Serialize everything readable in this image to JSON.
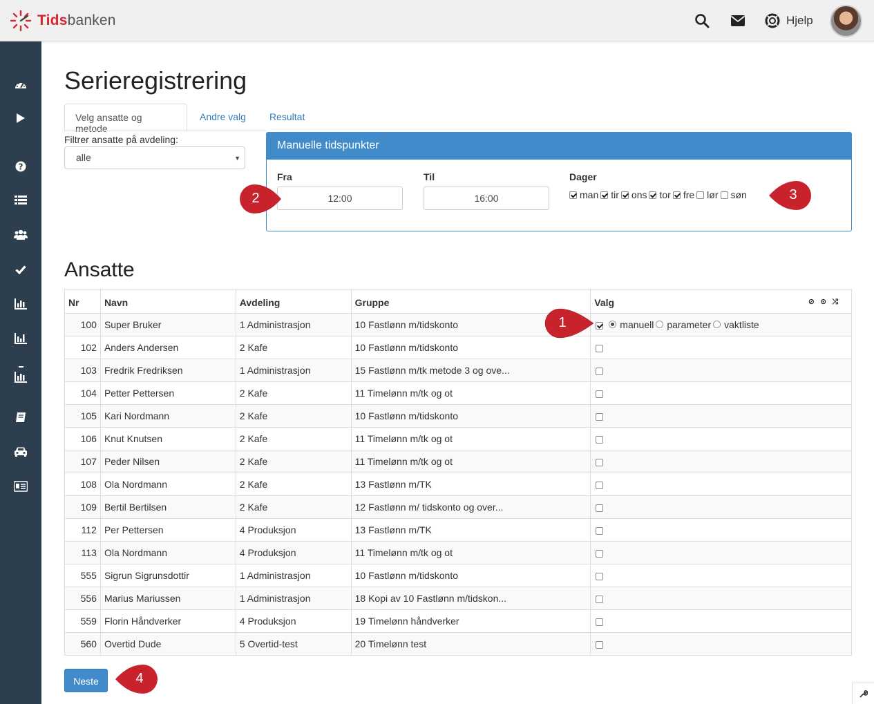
{
  "app": {
    "logo_part1": "Tids",
    "logo_part2": "banken"
  },
  "header": {
    "help_label": "Hjelp"
  },
  "sidebar": {
    "icons": [
      "dashboard-icon",
      "play-icon",
      "question-icon",
      "list-icon",
      "users-icon",
      "check-icon",
      "bar-chart-icon",
      "bar-chart-icon",
      "bar-chart-minus-icon",
      "book-icon",
      "car-icon",
      "id-card-icon"
    ]
  },
  "page": {
    "title": "Serieregistrering"
  },
  "tabs": [
    {
      "label": "Velg ansatte og metode",
      "active": true
    },
    {
      "label": "Andre valg",
      "active": false
    },
    {
      "label": "Resultat",
      "active": false
    }
  ],
  "filter": {
    "label": "Filtrer ansatte på avdeling:",
    "value": "alle"
  },
  "panel": {
    "title": "Manuelle tidspunkter",
    "fra_label": "Fra",
    "fra_value": "12:00",
    "til_label": "Til",
    "til_value": "16:00",
    "dager_label": "Dager",
    "days": [
      {
        "label": "man",
        "checked": true
      },
      {
        "label": "tir",
        "checked": true
      },
      {
        "label": "ons",
        "checked": true
      },
      {
        "label": "tor",
        "checked": true
      },
      {
        "label": "fre",
        "checked": true
      },
      {
        "label": "lør",
        "checked": false
      },
      {
        "label": "søn",
        "checked": false
      }
    ]
  },
  "employees": {
    "title": "Ansatte",
    "columns": [
      "Nr",
      "Navn",
      "Avdeling",
      "Gruppe",
      "Valg"
    ],
    "valg_options": [
      "manuell",
      "parameter",
      "vaktliste"
    ],
    "rows": [
      {
        "nr": "100",
        "navn": "Super Bruker",
        "avdeling": "1 Administrasjon",
        "gruppe": "10 Fastlønn m/tidskonto",
        "checked": true
      },
      {
        "nr": "102",
        "navn": "Anders Andersen",
        "avdeling": "2 Kafe",
        "gruppe": "10 Fastlønn m/tidskonto",
        "checked": false
      },
      {
        "nr": "103",
        "navn": "Fredrik Fredriksen",
        "avdeling": "1 Administrasjon",
        "gruppe": "15 Fastlønn m/tk metode 3 og ove...",
        "checked": false
      },
      {
        "nr": "104",
        "navn": "Petter Pettersen",
        "avdeling": "2 Kafe",
        "gruppe": "11 Timelønn m/tk og ot",
        "checked": false
      },
      {
        "nr": "105",
        "navn": "Kari Nordmann",
        "avdeling": "2 Kafe",
        "gruppe": "10 Fastlønn m/tidskonto",
        "checked": false
      },
      {
        "nr": "106",
        "navn": "Knut Knutsen",
        "avdeling": "2 Kafe",
        "gruppe": "11 Timelønn m/tk og ot",
        "checked": false
      },
      {
        "nr": "107",
        "navn": "Peder Nilsen",
        "avdeling": "2 Kafe",
        "gruppe": "11 Timelønn m/tk og ot",
        "checked": false
      },
      {
        "nr": "108",
        "navn": "Ola Nordmann",
        "avdeling": "2 Kafe",
        "gruppe": "13 Fastlønn m/TK",
        "checked": false
      },
      {
        "nr": "109",
        "navn": "Bertil Bertilsen",
        "avdeling": "2 Kafe",
        "gruppe": "12 Fastlønn m/ tidskonto og over...",
        "checked": false
      },
      {
        "nr": "112",
        "navn": "Per Pettersen",
        "avdeling": "4 Produksjon",
        "gruppe": "13 Fastlønn m/TK",
        "checked": false
      },
      {
        "nr": "113",
        "navn": "Ola Nordmann",
        "avdeling": "4 Produksjon",
        "gruppe": "11 Timelønn m/tk og ot",
        "checked": false
      },
      {
        "nr": "555",
        "navn": "Sigrun Sigrunsdottir",
        "avdeling": "1 Administrasjon",
        "gruppe": "10 Fastlønn m/tidskonto",
        "checked": false
      },
      {
        "nr": "556",
        "navn": "Marius Mariussen",
        "avdeling": "1 Administrasjon",
        "gruppe": "18 Kopi av 10 Fastlønn m/tidskon...",
        "checked": false
      },
      {
        "nr": "559",
        "navn": "Florin Håndverker",
        "avdeling": "4 Produksjon",
        "gruppe": "19 Timelønn håndverker",
        "checked": false
      },
      {
        "nr": "560",
        "navn": "Overtid Dude",
        "avdeling": "5 Overtid-test",
        "gruppe": "20 Timelønn test",
        "checked": false
      }
    ]
  },
  "buttons": {
    "neste": "Neste"
  },
  "markers": [
    "1",
    "2",
    "3",
    "4"
  ],
  "colors": {
    "primary": "#428bca",
    "sidebar": "#2d3e4e",
    "marker": "#c8232c",
    "logo_red": "#d6262f"
  }
}
